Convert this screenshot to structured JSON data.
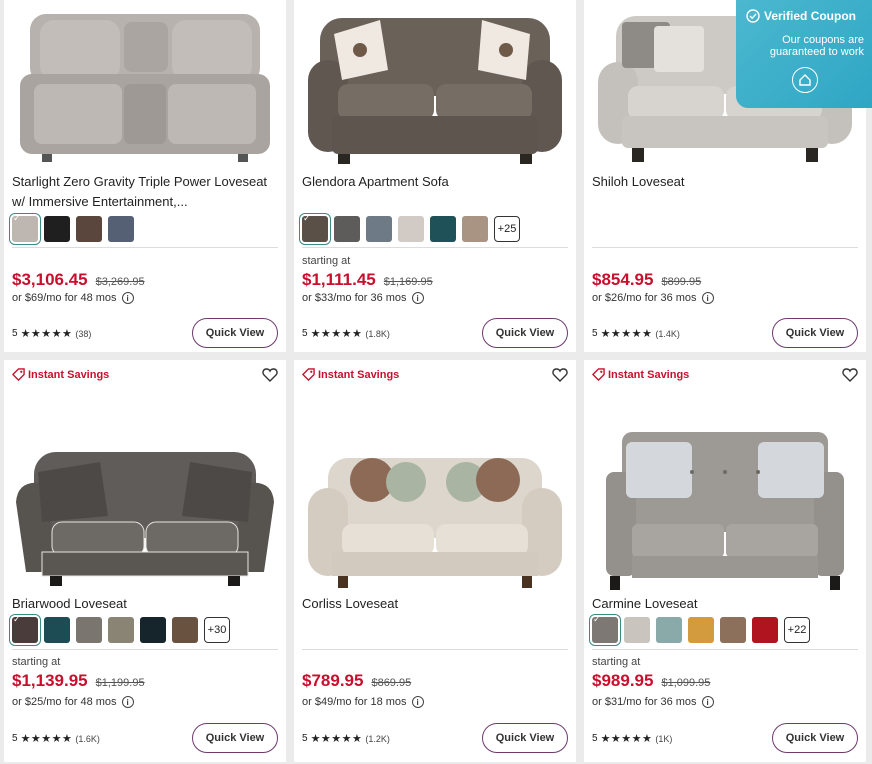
{
  "coupon": {
    "title": "Verified Coupon",
    "subtitle": "Our coupons are guaranteed to work"
  },
  "products": [
    {
      "name": "Starlight Zero Gravity Triple Power Loveseat w/ Immersive Entertainment,...",
      "price": "$3,106.45",
      "was": "$3,269.95",
      "finance": "or $69/mo for 48 mos",
      "rating": "5",
      "reviews": "(38)",
      "quick_view": "Quick View",
      "swatches": [
        "#bdb6b1",
        "#1f1f1f",
        "#5a463c",
        "#566075"
      ]
    },
    {
      "name": "Glendora Apartment Sofa",
      "starting": "starting at",
      "price": "$1,111.45",
      "was": "$1,169.95",
      "finance": "or $33/mo for 36 mos",
      "rating": "5",
      "reviews": "(1.8K)",
      "quick_view": "Quick View",
      "more": "+25",
      "swatches": [
        "#5b5048",
        "#5d5c5a",
        "#6f7a87",
        "#d2cac5",
        "#1f5258",
        "#a99484"
      ]
    },
    {
      "name": "Shiloh Loveseat",
      "price": "$854.95",
      "was": "$899.95",
      "finance": "or $26/mo for 36 mos",
      "rating": "5",
      "reviews": "(1.4K)",
      "quick_view": "Quick View"
    },
    {
      "badge": "Instant Savings",
      "name": "Briarwood Loveseat",
      "starting": "starting at",
      "price": "$1,139.95",
      "was": "$1,199.95",
      "finance": "or $25/mo for 48 mos",
      "rating": "5",
      "reviews": "(1.6K)",
      "quick_view": "Quick View",
      "more": "+30",
      "swatches": [
        "#4a3c3a",
        "#1d4c55",
        "#7a756f",
        "#8a8474",
        "#16242c",
        "#6a5240"
      ]
    },
    {
      "badge": "Instant Savings",
      "name": "Corliss Loveseat",
      "price": "$789.95",
      "was": "$869.95",
      "finance": "or $49/mo for 18 mos",
      "rating": "5",
      "reviews": "(1.2K)",
      "quick_view": "Quick View"
    },
    {
      "badge": "Instant Savings",
      "name": "Carmine Loveseat",
      "starting": "starting at",
      "price": "$989.95",
      "was": "$1,099.95",
      "finance": "or $31/mo for 36 mos",
      "rating": "5",
      "reviews": "(1K)",
      "quick_view": "Quick View",
      "more": "+22",
      "swatches": [
        "#7e7875",
        "#c9c4bd",
        "#8aa9a9",
        "#d49a3e",
        "#8c705c",
        "#b0141e"
      ]
    }
  ],
  "stars": "★★★★★",
  "colors": {
    "price_red": "#c8102e",
    "button_border": "#6e3a6e",
    "coupon_blue": "#3fb0c9"
  }
}
